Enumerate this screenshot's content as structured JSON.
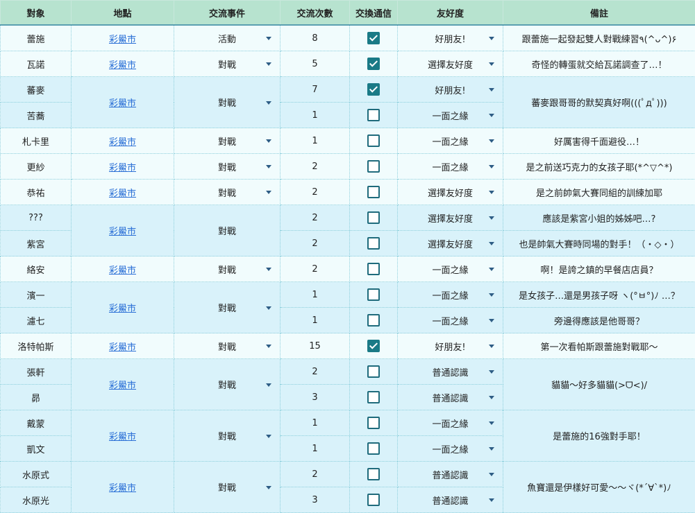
{
  "headers": {
    "target": "對象",
    "location": "地點",
    "event": "交流事件",
    "count": "交流次數",
    "exchange": "交換通信",
    "friendship": "友好度",
    "note": "備註"
  },
  "rows": [
    {
      "name": "蕾施",
      "loc": "彩鱟市",
      "event": "活動",
      "count": "8",
      "exchange": true,
      "friend": "好朋友!",
      "note": "跟蕾施一起發起雙人對戰練習٩(^ᴗ^)۶"
    },
    {
      "name": "瓦諾",
      "loc": "彩鱟市",
      "event": "對戰",
      "count": "5",
      "exchange": true,
      "friend": "選擇友好度",
      "note": "奇怪的轉蛋就交給瓦諾調查了…！"
    },
    {
      "name": "蕃麥",
      "loc": "彩鱟市",
      "event": "對戰",
      "count": "7",
      "exchange": true,
      "friend": "好朋友!",
      "note": "蕃麥跟哥哥的默契真好啊(((ﾟдﾟ)))"
    },
    {
      "name": "苦蕎",
      "count": "1",
      "exchange": false,
      "friend": "一面之緣"
    },
    {
      "name": "札卡里",
      "loc": "彩鱟市",
      "event": "對戰",
      "count": "1",
      "exchange": false,
      "friend": "一面之緣",
      "note": "好厲害得千面避役…！"
    },
    {
      "name": "更紗",
      "loc": "彩鱟市",
      "event": "對戰",
      "count": "2",
      "exchange": false,
      "friend": "一面之緣",
      "note": "是之前送巧克力的女孩子耶(*^▽^*)"
    },
    {
      "name": "恭祐",
      "loc": "彩鱟市",
      "event": "對戰",
      "count": "2",
      "exchange": false,
      "friend": "選擇友好度",
      "note": "是之前帥氣大賽同組的訓練加耶"
    },
    {
      "name": "???",
      "loc": "彩鱟市",
      "event": "對戰",
      "count": "2",
      "exchange": false,
      "friend": "選擇友好度",
      "note": "應該是紫宮小姐的姊姊吧…?"
    },
    {
      "name": "紫宮",
      "count": "2",
      "exchange": false,
      "friend": "選擇友好度",
      "note": "也是帥氣大賽時同場的對手！（・◇・）"
    },
    {
      "name": "絡安",
      "loc": "彩鱟市",
      "event": "對戰",
      "count": "2",
      "exchange": false,
      "friend": "一面之緣",
      "note": "啊！是誇之鎮的早餐店店員？"
    },
    {
      "name": "濱一",
      "loc": "彩鱟市",
      "event": "對戰",
      "count": "1",
      "exchange": false,
      "friend": "一面之緣",
      "note": "是女孩子…還是男孩子呀 ヽ(°ㅂ°)ﾉ …？"
    },
    {
      "name": "濾七",
      "count": "1",
      "exchange": false,
      "friend": "一面之緣",
      "note": "旁邊得應該是他哥哥？"
    },
    {
      "name": "洛特帕斯",
      "loc": "彩鱟市",
      "event": "對戰",
      "count": "15",
      "exchange": true,
      "friend": "好朋友!",
      "note": "第一次看帕斯跟蕾施對戰耶～"
    },
    {
      "name": "張軒",
      "loc": "彩鱟市",
      "event": "對戰",
      "count": "2",
      "exchange": false,
      "friend": "普通認識",
      "note": "貓貓～好多貓貓(>ᗜ<)/"
    },
    {
      "name": "昴",
      "count": "3",
      "exchange": false,
      "friend": "普通認識"
    },
    {
      "name": "戴蒙",
      "loc": "彩鱟市",
      "event": "對戰",
      "count": "1",
      "exchange": false,
      "friend": "一面之緣",
      "note": "是蕾施的16強對手耶！"
    },
    {
      "name": "凱文",
      "count": "1",
      "exchange": false,
      "friend": "一面之緣"
    },
    {
      "name": "水原式",
      "loc": "彩鱟市",
      "event": "對戰",
      "count": "2",
      "exchange": false,
      "friend": "普通認識",
      "note": "魚寶還是伊樣好可愛～～ヾ(*´∀`*)ﾉ"
    },
    {
      "name": "水原光",
      "count": "3",
      "exchange": false,
      "friend": "普通認識"
    }
  ]
}
